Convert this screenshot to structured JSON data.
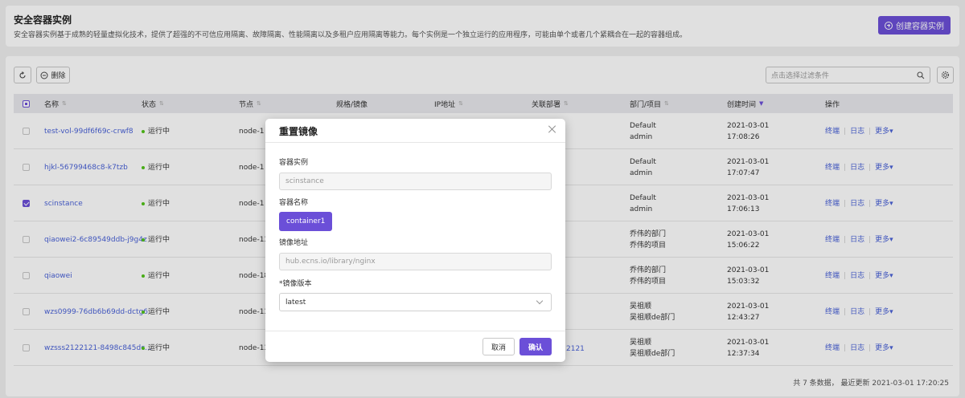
{
  "header": {
    "title": "安全容器实例",
    "description": "安全容器实例基于成熟的轻量虚拟化技术，提供了超强的不可信应用隔离、故障隔离、性能隔离以及多租户应用隔离等能力。每个实例是一个独立运行的应用程序，可能由单个或者几个紧耦合在一起的容器组成。",
    "create_button": "创建容器实例"
  },
  "toolbar": {
    "delete_label": "删除",
    "filter_placeholder": "点击选择过滤条件"
  },
  "table": {
    "columns": [
      "名称",
      "状态",
      "节点",
      "规格/镜像",
      "IP地址",
      "关联部署",
      "部门/项目",
      "创建时间",
      "操作"
    ],
    "rows": [
      {
        "name": "test-vol-99df6f69c-crwf8",
        "status": "运行中",
        "node": "node-1",
        "dept": "Default",
        "project": "admin",
        "date": "2021-03-01",
        "time": "17:08:26",
        "checked": false
      },
      {
        "name": "hjkl-56799468c8-k7tzb",
        "status": "运行中",
        "node": "node-1",
        "dept": "Default",
        "project": "admin",
        "date": "2021-03-01",
        "time": "17:07:47",
        "checked": false
      },
      {
        "name": "scinstance",
        "status": "运行中",
        "node": "node-1",
        "dept": "Default",
        "project": "admin",
        "date": "2021-03-01",
        "time": "17:06:13",
        "checked": true
      },
      {
        "name": "qiaowei2-6c89549ddb-j9g4z",
        "status": "运行中",
        "node": "node-13",
        "dept": "乔伟的部门",
        "project": "乔伟的项目",
        "date": "2021-03-01",
        "time": "15:06:22",
        "checked": false
      },
      {
        "name": "qiaowei",
        "status": "运行中",
        "node": "node-18",
        "dept": "乔伟的部门",
        "project": "乔伟的项目",
        "date": "2021-03-01",
        "time": "15:03:32",
        "checked": false
      },
      {
        "name": "wzs0999-76db6b69dd-dctg6",
        "status": "运行中",
        "node": "node-13",
        "dept": "吴祖顺",
        "project": "吴祖顺de部门",
        "date": "2021-03-01",
        "time": "12:43:27",
        "checked": false
      },
      {
        "name": "wzsss2122121-8498c845dc...",
        "status": "运行中",
        "node": "node-13",
        "dept": "吴祖顺",
        "project": "吴祖顺de部门",
        "date": "2021-03-01",
        "time": "12:37:34",
        "checked": false
      }
    ],
    "ops": {
      "terminal": "终端",
      "log": "日志",
      "more": "更多▾"
    },
    "partial_link": "2121"
  },
  "footer": "共 7 条数据， 最近更新  2021-03-01 17:20:25",
  "modal": {
    "title": "重置镜像",
    "instance_label": "容器实例",
    "instance_value": "scinstance",
    "container_name_label": "容器名称",
    "container_tag": "container1",
    "image_addr_label": "镜像地址",
    "image_addr_value": "hub.ecns.io/library/nginx",
    "image_version_label": "*镜像版本",
    "image_version_value": "latest",
    "cancel": "取消",
    "confirm": "确认"
  },
  "colors": {
    "accent": "#6b4fd8",
    "link": "#4a62d8",
    "running": "#52c41a"
  }
}
